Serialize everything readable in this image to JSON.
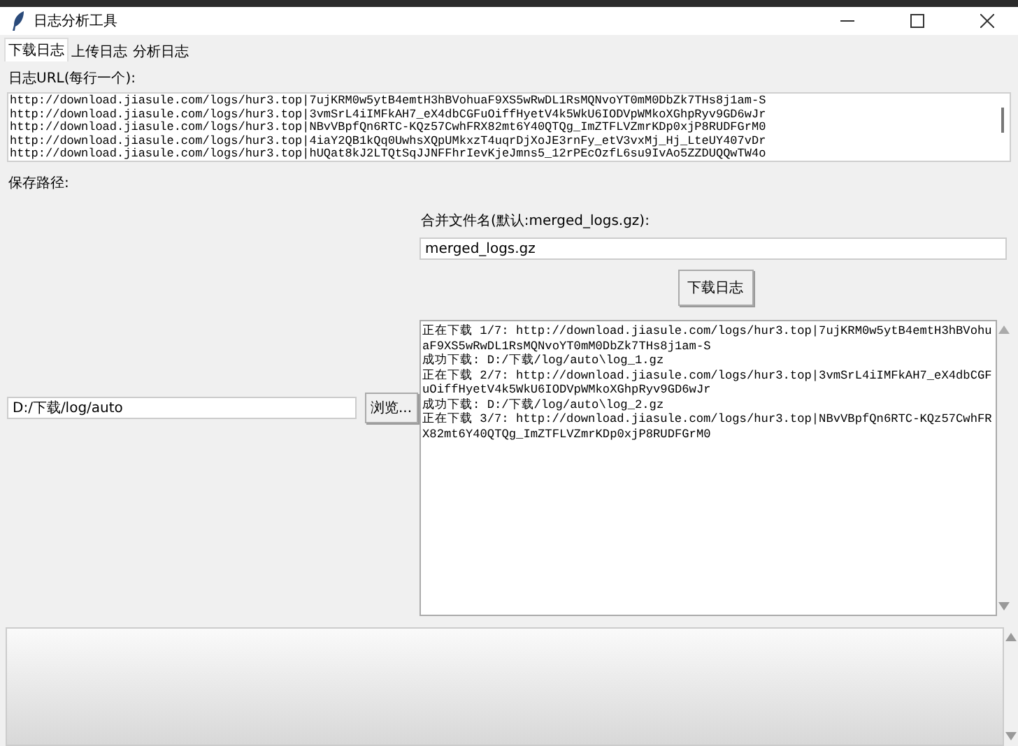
{
  "window": {
    "title": "日志分析工具"
  },
  "tabs": [
    {
      "label": "下载日志",
      "selected": true
    },
    {
      "label": "上传日志",
      "selected": false
    },
    {
      "label": "分析日志",
      "selected": false
    }
  ],
  "url_section": {
    "label": "日志URL(每行一个):",
    "lines": [
      "http://download.jiasule.com/logs/hur3.top|7ujKRM0w5ytB4emtH3hBVohuaF9XS5wRwDL1RsMQNvoYT0mM0DbZk7THs8j1am-S",
      "http://download.jiasule.com/logs/hur3.top|3vmSrL4iIMFkAH7_eX4dbCGFuOiffHyetV4k5WkU6IODVpWMkoXGhpRyv9GD6wJr",
      "http://download.jiasule.com/logs/hur3.top|NBvVBpfQn6RTC-KQz57CwhFRX82mt6Y40QTQg_ImZTFLVZmrKDp0xjP8RUDFGrM0",
      "http://download.jiasule.com/logs/hur3.top|4iaY2QB1kQq0UwhsXQpUMkxzT4uqrDjXoJE3rnFy_etV3vxMj_Hj_LteUY407vDr",
      "http://download.jiasule.com/logs/hur3.top|hUQat8kJ2LTQtSqJJNFFhrIevKjeJmns5_12rPEcOzfL6su9IvAo5ZZDUQQwTW4o"
    ]
  },
  "save_path": {
    "label": "保存路径:",
    "value": "D:/下载/log/auto",
    "browse_button": "浏览..."
  },
  "merge": {
    "label": "合并文件名(默认:merged_logs.gz):",
    "value": "merged_logs.gz"
  },
  "download_button": "下载日志",
  "log_lines": [
    "正在下载 1/7: http://download.jiasule.com/logs/hur3.top|7ujKRM0w5ytB4emtH3hBVohu",
    "aF9XS5wRwDL1RsMQNvoYT0mM0DbZk7THs8j1am-S",
    "成功下载: D:/下载/log/auto\\log_1.gz",
    "正在下载 2/7: http://download.jiasule.com/logs/hur3.top|3vmSrL4iIMFkAH7_eX4dbCGF",
    "uOiffHyetV4k5WkU6IODVpWMkoXGhpRyv9GD6wJr",
    "成功下载: D:/下载/log/auto\\log_2.gz",
    "正在下载 3/7: http://download.jiasule.com/logs/hur3.top|NBvVBpfQn6RTC-KQz57CwhFR",
    "X82mt6Y40QTQg_ImZTFLVZmrKDp0xjP8RUDFGrM0"
  ]
}
